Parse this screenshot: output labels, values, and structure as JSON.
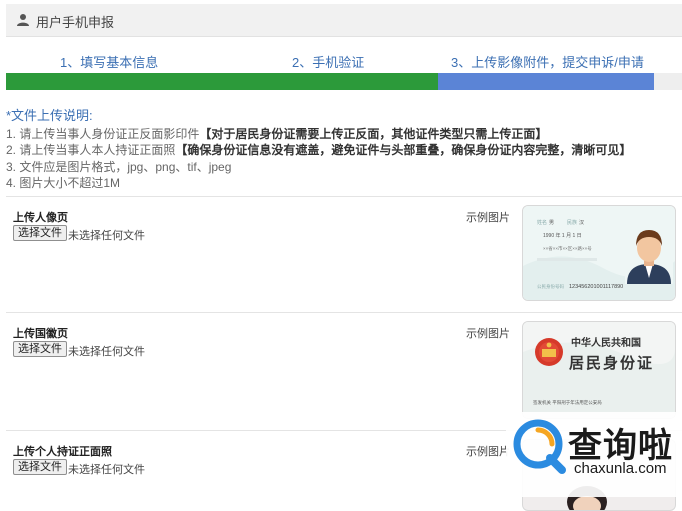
{
  "header": {
    "title": "用户手机申报",
    "icon": "user-icon"
  },
  "steps": [
    {
      "label": "1、填写基本信息"
    },
    {
      "label": "2、手机验证"
    },
    {
      "label": "3、上传影像附件，提交申诉/申请"
    }
  ],
  "progress": {
    "current_step": 3,
    "total_steps": 3,
    "done_color": "#2c9a3a",
    "current_color": "#5b84d6"
  },
  "instructions": {
    "heading": "*文件上传说明:",
    "line1_pre": "1. 请上传当事人身份证正反面影印件",
    "line1_bold": "【对于居民身份证需要上传正反面，其他证件类型只需上传正面】",
    "line2_pre": "2. 请上传当事人本人持证正面照",
    "line2_bold": "【确保身份证信息没有遮盖，避免证件与头部重叠，确保身份证内容完整，清晰可见】",
    "line3": "3. 文件应是图片格式，jpg、png、tif、jpeg",
    "line4": "4. 图片大小不超过1M"
  },
  "uploads": [
    {
      "label": "上传人像页",
      "button": "选择文件",
      "status": "未选择任何文件",
      "sample_label": "示例图片"
    },
    {
      "label": "上传国徽页",
      "button": "选择文件",
      "status": "未选择任何文件",
      "sample_label": "示例图片"
    },
    {
      "label": "上传个人持证正面照",
      "button": "选择文件",
      "status": "未选择任何文件",
      "sample_label": "示例图片"
    }
  ],
  "sample_cards": {
    "portrait": {
      "name_label": "姓名",
      "name_value": "男",
      "ethnic_label": "民族",
      "ethnic_value": "汉",
      "birth": "1990  年  1  月  1 日",
      "address": "××省××市××区××路××号",
      "id_label": "公民身份号码",
      "id_number": "123456201001117890"
    },
    "emblem": {
      "title": "中华人民共和国",
      "subtitle": "居民身份证",
      "issuer": "签发机关  平阳刑于年法用定公安局"
    }
  },
  "watermark": {
    "cn": "查询啦",
    "en": "chaxunla.com"
  }
}
